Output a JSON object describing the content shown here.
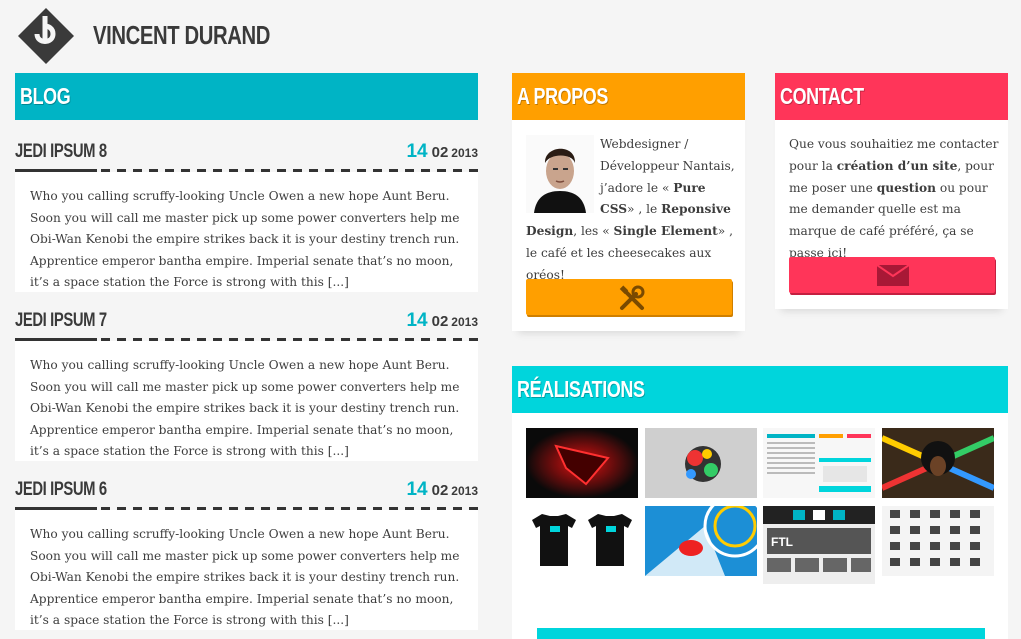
{
  "site": {
    "title": "Vincent Durand"
  },
  "blog": {
    "heading": "BLOG",
    "posts": [
      {
        "title": "JEDI IPSUM 8",
        "day": "14",
        "month": "02",
        "year": "2013",
        "excerpt": "Who you calling scruffy-looking Uncle Owen a new hope Aunt Beru. Soon you will call me master pick up some power converters help me Obi-Wan Kenobi the empire strikes back it is your destiny trench run. Apprentice emperor bantha empire. Imperial senate that’s no moon, it’s a space station the Force is strong with this [...]"
      },
      {
        "title": "JEDI IPSUM 7",
        "day": "14",
        "month": "02",
        "year": "2013",
        "excerpt": "Who you calling scruffy-looking Uncle Owen a new hope Aunt Beru. Soon you will call me master pick up some power converters help me Obi-Wan Kenobi the empire strikes back it is your destiny trench run. Apprentice emperor bantha empire. Imperial senate that’s no moon, it’s a space station the Force is strong with this [...]"
      },
      {
        "title": "JEDI IPSUM 6",
        "day": "14",
        "month": "02",
        "year": "2013",
        "excerpt": "Who you calling scruffy-looking Uncle Owen a new hope Aunt Beru. Soon you will call me master pick up some power converters help me Obi-Wan Kenobi the empire strikes back it is your destiny trench run. Apprentice emperor bantha empire. Imperial senate that’s no moon, it’s a space station the Force is strong with this [...]"
      }
    ]
  },
  "about": {
    "heading": "A PROPOS",
    "t1": "Webdesigner / Développeur Nantais, j’adore le « ",
    "b1": "Pure CSS",
    "t2": "» , le ",
    "b2": "Reponsive Design",
    "t3": ", les « ",
    "b3": "Single Element",
    "t4": "» , le café et les cheesecakes aux oréos!",
    "button_icon": "tools-icon"
  },
  "contact": {
    "heading": "CONTACT",
    "t1": "Que vous souhaitiez me contacter pour la ",
    "b1": "création d’un site",
    "t2": ", pour me poser une ",
    "b2": "question",
    "t3": " ou pour me demander quelle est ma marque de café préféré, ça se passe ici!",
    "button_icon": "envelope-icon"
  },
  "works": {
    "heading": "RÉALISATIONS",
    "thumbnails": [
      "rog-wallpaper",
      "grunge-art",
      "website-mockup",
      "afro-art",
      "tshirts",
      "rolling-stones-art",
      "ftl-website",
      "icon-grid"
    ]
  },
  "colors": {
    "blog": "#00b4c5",
    "about": "#ff9f00",
    "contact": "#ff3559",
    "works": "#00d5dc"
  }
}
